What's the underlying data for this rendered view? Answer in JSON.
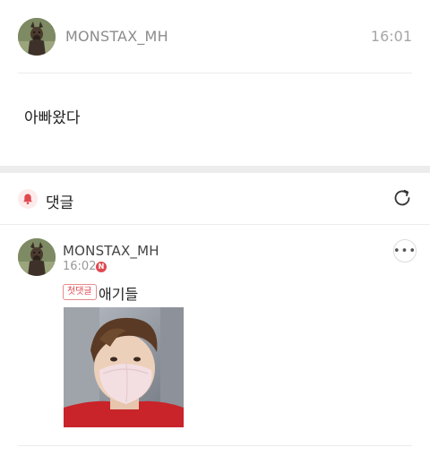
{
  "post": {
    "author": "MONSTAX_MH",
    "time": "16:01",
    "body": "아빠왔다"
  },
  "comments_section": {
    "title": "댓글"
  },
  "comment": {
    "author": "MONSTAX_MH",
    "time": "16:02",
    "new_badge": "N",
    "first_comment_badge": "첫댓글",
    "text": "애기들",
    "more_label": "•••"
  },
  "icons": {
    "bell": "bell-icon",
    "refresh": "refresh-icon",
    "more": "more-dots-icon",
    "avatar": "dog-avatar-icon"
  },
  "colors": {
    "accent_red": "#e0484f",
    "badge_border": "#e58a8e",
    "separator": "#ececec",
    "muted_text": "#8c8c8c"
  }
}
